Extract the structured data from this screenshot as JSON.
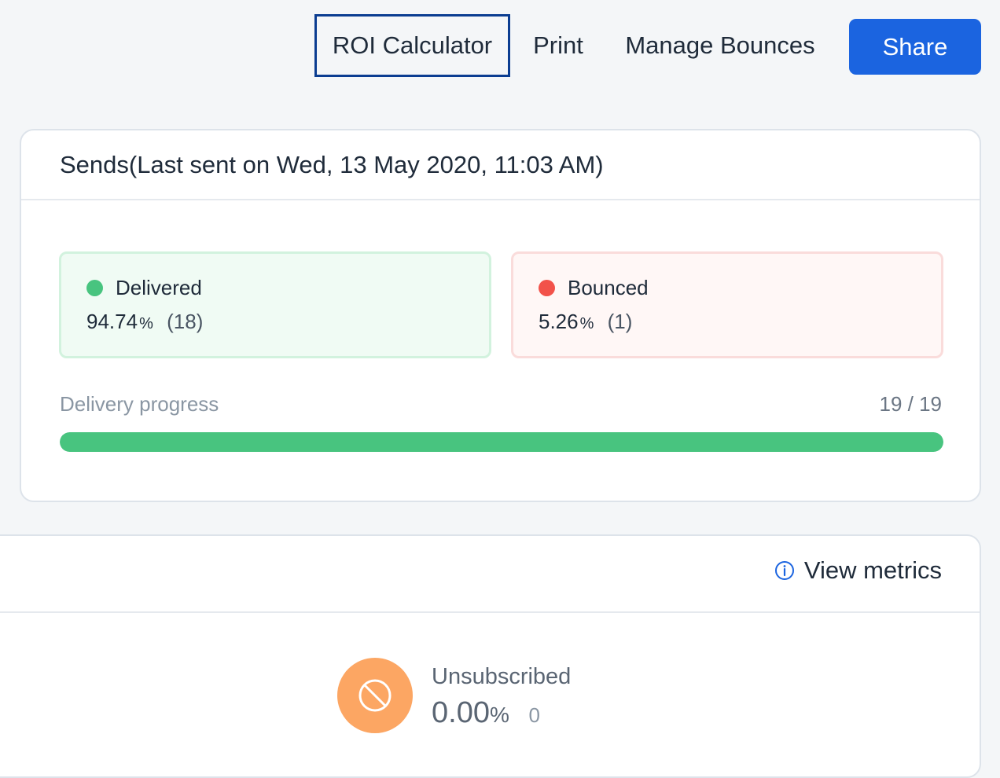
{
  "toolbar": {
    "roi_label": "ROI Calculator",
    "print_label": "Print",
    "bounces_label": "Manage Bounces",
    "share_label": "Share"
  },
  "sends": {
    "title": "Sends(Last sent on Wed, 13 May 2020, 11:03 AM)",
    "delivered": {
      "label": "Delivered",
      "percent": "94.74",
      "percent_sign": "%",
      "count": "(18)",
      "color": "#48c47f"
    },
    "bounced": {
      "label": "Bounced",
      "percent": "5.26",
      "percent_sign": "%",
      "count": "(1)",
      "color": "#f2524a"
    },
    "progress": {
      "label": "Delivery progress",
      "count": "19 / 19",
      "fraction": 1.0
    }
  },
  "metrics": {
    "view_label": "View metrics",
    "unsubscribed": {
      "label": "Unsubscribed",
      "percent": "0.00",
      "percent_sign": "%",
      "count": "0",
      "icon": "block-icon"
    }
  },
  "colors": {
    "accent": "#1b64e0",
    "success": "#48c47f",
    "danger": "#f2524a",
    "warning": "#fca663"
  }
}
